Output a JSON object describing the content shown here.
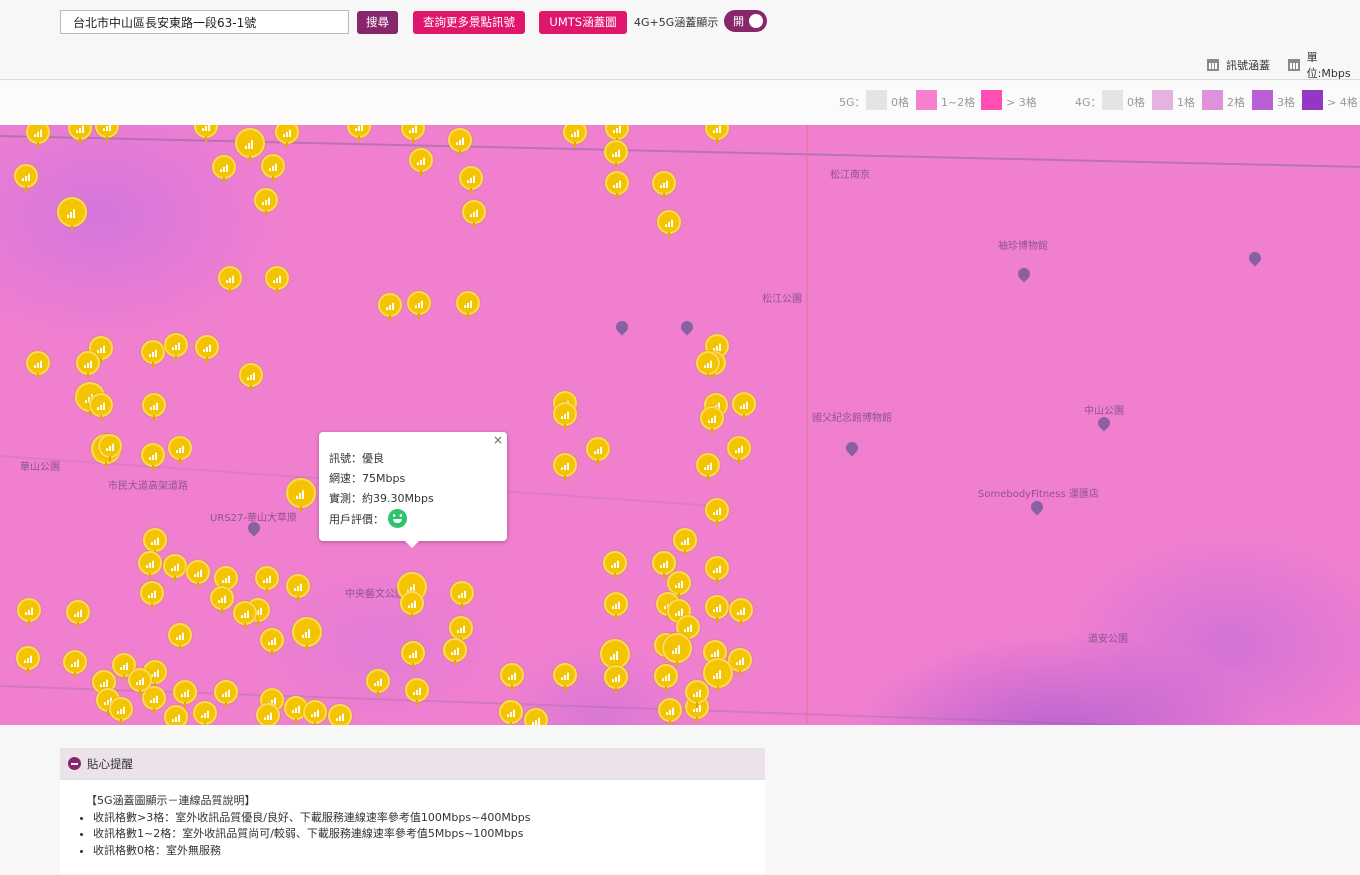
{
  "search": {
    "value": "台北市中山區長安東路一段63-1號"
  },
  "buttons": {
    "search": "搜尋",
    "more": "查詢更多景點訊號",
    "umts": "UMTS涵蓋圖"
  },
  "toggle": {
    "label": "4G+5G涵蓋顯示",
    "state": "開",
    "on": true
  },
  "tools": {
    "signal": "訊號涵蓋",
    "unit": "單位:Mbps"
  },
  "legend": {
    "g5_title": "5G：",
    "g5": [
      {
        "label": "0格",
        "color": "#e4e4e4"
      },
      {
        "label": "1~2格",
        "color": "#f77fd0"
      },
      {
        "label": "> 3格",
        "color": "#ff4fb5"
      }
    ],
    "g4_title": "4G：",
    "g4": [
      {
        "label": "0格",
        "color": "#e4e4e4"
      },
      {
        "label": "1格",
        "color": "#e8b2e0"
      },
      {
        "label": "2格",
        "color": "#de92d9"
      },
      {
        "label": "3格",
        "color": "#b85fd6"
      },
      {
        "label": "> 4格",
        "color": "#9338c5"
      }
    ]
  },
  "map_labels": {
    "l1": "松江公園",
    "l2": "袖珍博物館",
    "l3": "中山公園",
    "l4": "國父紀念館博物館",
    "l5": "SomebodyFitness 運匯店",
    "l6": "華山公園",
    "l7": "URS27-華山大草原",
    "l8": "中央藝文公園",
    "l9": "道安公園",
    "l10": "松江南京",
    "l11": "市民大道高架道路"
  },
  "popup": {
    "signal": "訊號：優良",
    "speed": "網速：75Mbps",
    "measured": "實測：約39.30Mbps",
    "rating": "用戶評價：",
    "close": "×"
  },
  "tips": {
    "title": "貼心提醒",
    "heading": "【5G涵蓋圖顯示－連線品質說明】",
    "items": [
      "收訊格數>3格：室外收訊品質優良/良好、下載服務連線速率參考值100Mbps~400Mbps",
      "收訊格數1~2格：室外收訊品質尚可/較弱、下載服務連線速率參考值5Mbps~100Mbps",
      "收訊格數0格：室外無服務"
    ]
  }
}
